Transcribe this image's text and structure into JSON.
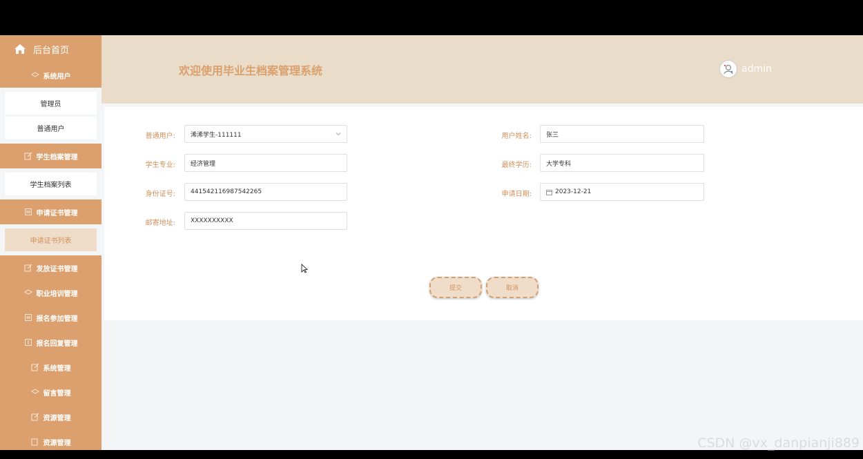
{
  "sidebar": {
    "home_label": "后台首页",
    "sections": [
      {
        "label": "系统用户",
        "items": [
          "管理员",
          "普通用户"
        ]
      },
      {
        "label": "学生档案管理",
        "items": [
          "学生档案列表"
        ]
      },
      {
        "label": "申请证书管理",
        "items": [
          "申请证书列表"
        ]
      },
      {
        "label": "发放证书管理",
        "items": []
      },
      {
        "label": "职业培训管理",
        "items": []
      },
      {
        "label": "报名参加管理",
        "items": []
      },
      {
        "label": "报名回复管理",
        "items": []
      },
      {
        "label": "系统管理",
        "items": []
      },
      {
        "label": "留言管理",
        "items": []
      },
      {
        "label": "资源管理",
        "items": []
      },
      {
        "label": "资源管理",
        "items": []
      }
    ],
    "active_item": "申请证书列表"
  },
  "header": {
    "title": "欢迎使用毕业生档案管理系统",
    "username": "admin"
  },
  "form": {
    "user": {
      "label": "普通用户:",
      "value": "浠浠学生-111111"
    },
    "name": {
      "label": "用户姓名:",
      "value": "张三"
    },
    "major": {
      "label": "学生专业:",
      "value": "经济管理"
    },
    "education": {
      "label": "最终学历:",
      "value": "大学专科"
    },
    "idcard": {
      "label": "身份证号:",
      "value": "441542116987542265"
    },
    "date": {
      "label": "申请日期:",
      "value": "2023-12-21"
    },
    "address": {
      "label": "邮寄地址:",
      "value": "XXXXXXXXXX"
    },
    "submit_label": "提交",
    "cancel_label": "取消"
  },
  "watermark": "CSDN @vx_danpianji889",
  "colors": {
    "accent": "#dba06d",
    "header_bg": "#e9dcc8",
    "label": "#d0925c"
  }
}
